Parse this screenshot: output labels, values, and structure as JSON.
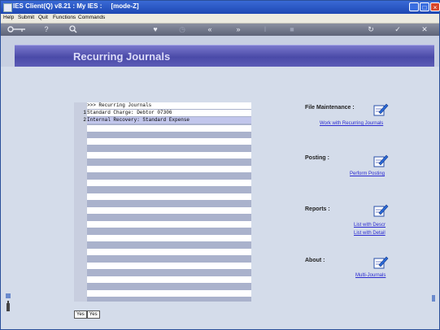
{
  "window": {
    "title": "IES Client(Q) v8.21 : My IES :     [mode-Z]",
    "buttons": {
      "minimize": "_",
      "maximize": "□",
      "close": "×"
    }
  },
  "menu": {
    "items": [
      "Help",
      "Submit",
      "Quit",
      "Functions",
      "Commands"
    ]
  },
  "toolbar": {
    "icons": [
      "key-icon",
      "help-icon",
      "search-icon",
      "heart-icon",
      "clock-icon",
      "rewind-icon",
      "fast-forward-icon",
      "text-cursor-icon",
      "stop-icon",
      "refresh-icon",
      "confirm-icon",
      "cancel-icon"
    ]
  },
  "header": {
    "title": "Recurring Journals"
  },
  "list": {
    "header": ">>> Recurring Journals",
    "items": [
      {
        "num": "1",
        "text": "Standard Charge: Debtor 07306"
      },
      {
        "num": "2",
        "text": "Internal Recovery: Standard Expense"
      }
    ]
  },
  "tabs": [
    "Yes",
    "Yes"
  ],
  "sections": {
    "file_maintenance": {
      "label": "File Maintenance :",
      "links": [
        "Work with Recurring Journals"
      ]
    },
    "posting": {
      "label": "Posting :",
      "links": [
        "Perform Posting"
      ]
    },
    "reports": {
      "label": "Reports :",
      "links": [
        "List with Descr",
        "List with Detail"
      ]
    },
    "about": {
      "label": "About :",
      "links": [
        "Multi-Journals"
      ]
    }
  }
}
